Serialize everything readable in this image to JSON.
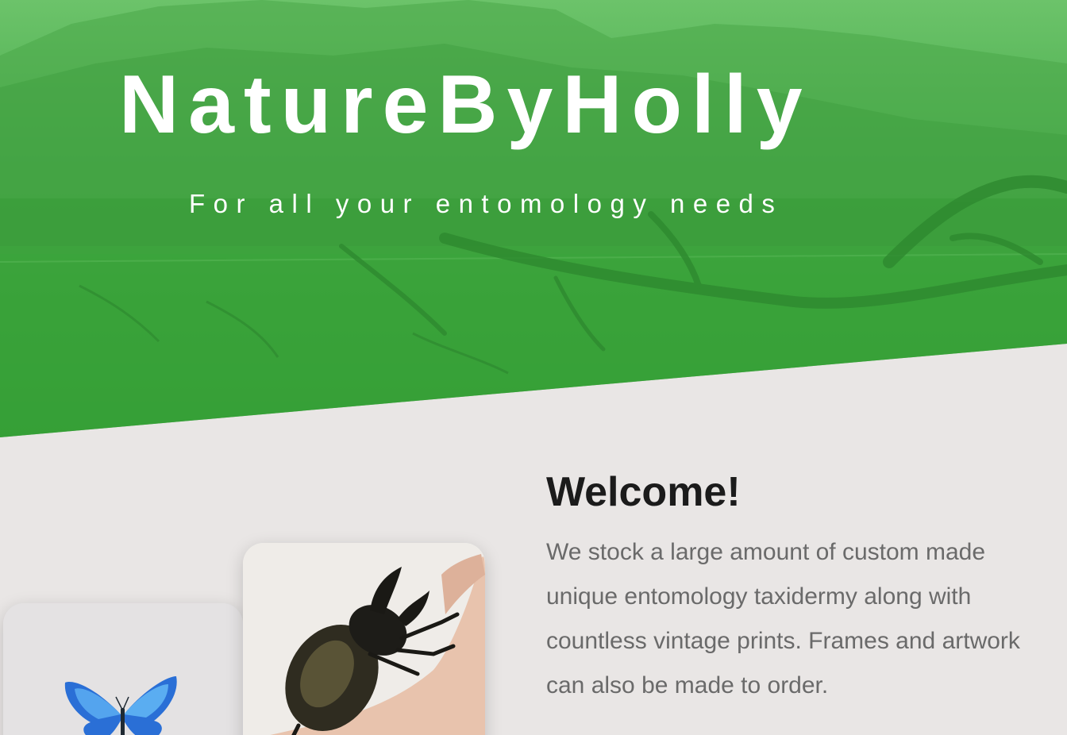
{
  "hero": {
    "title": "NatureByHolly",
    "subtitle": "For all your entomology needs"
  },
  "welcome": {
    "heading": "Welcome!",
    "text": "We stock a large amount of custom made unique entomology taxidermy along with countless vintage prints. Frames and artwork can also be made to order."
  },
  "colors": {
    "hero_green": "#3aa23a",
    "background": "#e9e6e5",
    "heading": "#1b1b1b",
    "body_text": "#6a6a6a"
  }
}
